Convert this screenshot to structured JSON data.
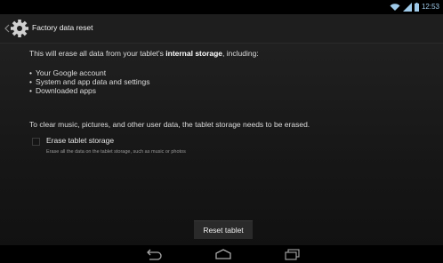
{
  "status_bar": {
    "time": "12:53",
    "icons": [
      "wifi-icon",
      "signal-icon",
      "battery-icon"
    ],
    "accent_color": "#9ec9e8"
  },
  "action_bar": {
    "title": "Factory data reset",
    "icon": "gear-icon"
  },
  "content": {
    "intro_prefix": "This will erase all data from your tablet's ",
    "intro_bold": "internal storage",
    "intro_suffix": ", including:",
    "bullets": [
      "Your Google account",
      "System and app data and settings",
      "Downloaded apps"
    ],
    "note": "To clear music, pictures, and other user data, the tablet storage needs to be erased.",
    "erase_option": {
      "title": "Erase tablet storage",
      "description": "Erase all the data on the tablet storage, such as music or photos",
      "checked": false
    },
    "reset_button": "Reset tablet"
  },
  "nav_bar": {
    "buttons": [
      "back-icon",
      "home-icon",
      "recent-apps-icon"
    ]
  }
}
